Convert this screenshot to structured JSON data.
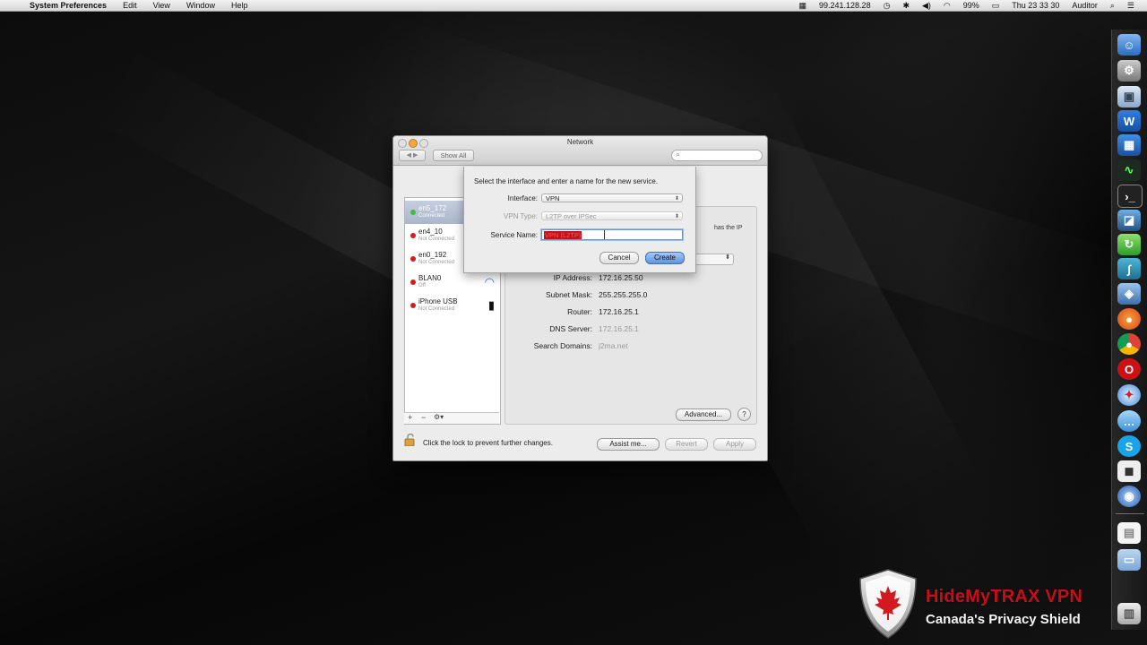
{
  "menubar": {
    "app_name": "System Preferences",
    "menus": [
      "Edit",
      "View",
      "Window",
      "Help"
    ],
    "ip_address": "99.241.128.28",
    "battery": "99%",
    "clock": "Thu 23 33 30",
    "user": "Auditor",
    "icons": [
      "apple-icon",
      "vpn-status-icon",
      "time-machine-icon",
      "bluetooth-icon",
      "volume-icon",
      "wifi-icon",
      "battery-icon",
      "spotlight-icon"
    ]
  },
  "window": {
    "title": "Network",
    "show_all_label": "Show All",
    "search_placeholder": ""
  },
  "services": [
    {
      "name": "en5_172",
      "status": "Connected",
      "status_color": "#3cbf3c",
      "selected": true
    },
    {
      "name": "en4_10",
      "status": "Not Connected",
      "status_color": "#d11d1d",
      "selected": false
    },
    {
      "name": "en0_192",
      "status": "Not Connected",
      "status_color": "#d11d1d",
      "selected": false
    },
    {
      "name": "BLAN0",
      "status": "Off",
      "status_color": "#d11d1d",
      "selected": false
    },
    {
      "name": "iPhone USB",
      "status": "Not Connected",
      "status_color": "#d11d1d",
      "selected": false
    }
  ],
  "sidebar_tools": {
    "add": "+",
    "remove": "−",
    "gear": "⚙▾"
  },
  "details": {
    "hint": "has the IP",
    "ip_label": "IP Address:",
    "ip_value": "172.16.25.50",
    "subnet_label": "Subnet Mask:",
    "subnet_value": "255.255.255.0",
    "router_label": "Router:",
    "router_value": "172.16.25.1",
    "dns_label": "DNS Server:",
    "dns_value": "172.16.25.1",
    "search_domains_label": "Search Domains:",
    "search_domains_value": "j2ma.net",
    "advanced_label": "Advanced...",
    "help_label": "?"
  },
  "footer": {
    "lock_text": "Click the lock to prevent further changes.",
    "assist_label": "Assist me...",
    "revert_label": "Revert",
    "apply_label": "Apply"
  },
  "sheet": {
    "prompt": "Select the interface and enter a name for the new service.",
    "interface_label": "Interface:",
    "interface_value": "VPN",
    "vpn_type_label": "VPN Type:",
    "vpn_type_value": "L2TP over IPSec",
    "service_name_label": "Service Name:",
    "service_name_value": "VPN (L2TP)",
    "cancel_label": "Cancel",
    "create_label": "Create"
  },
  "dock": {
    "items": [
      "finder-icon",
      "system-preferences-icon",
      "preview-icon",
      "word-icon",
      "calculator-icon",
      "activity-monitor-icon",
      "terminal-icon",
      "photo-icon",
      "sync-icon",
      "network-utility-icon",
      "virtualbox-icon",
      "firefox-icon",
      "chrome-icon",
      "opera-icon",
      "safari-icon",
      "messages-icon",
      "skype-icon",
      "app-icon",
      "network-globe-icon"
    ],
    "docs": [
      "document-icon",
      "folder-icon",
      "trash-icon"
    ]
  },
  "watermark": {
    "title": "HideMyTRAX VPN",
    "subtitle": "Canada's Privacy Shield"
  }
}
